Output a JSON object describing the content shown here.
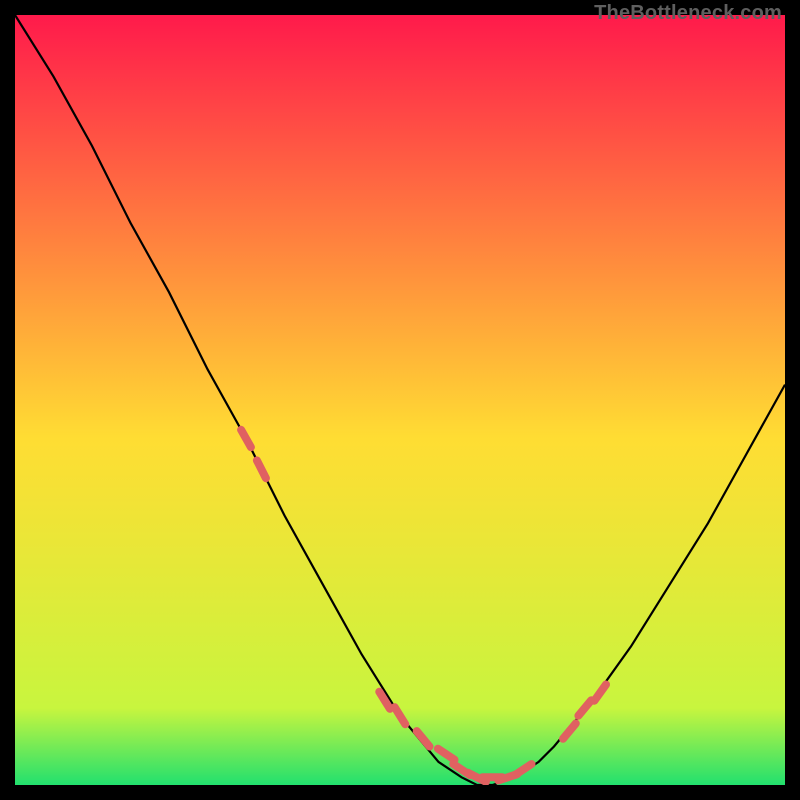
{
  "watermark": "TheBottleneck.com",
  "colors": {
    "bg": "#000000",
    "curve": "#000000",
    "marker": "#e06161",
    "grad_top": "#ff1a4b",
    "grad_mid": "#ffdd33",
    "grad_bottom": "#22e06e"
  },
  "chart_data": {
    "type": "line",
    "title": "",
    "xlabel": "",
    "ylabel": "",
    "xlim": [
      0,
      100
    ],
    "ylim": [
      0,
      100
    ],
    "grid": false,
    "legend_position": "none",
    "annotations": [
      "TheBottleneck.com"
    ],
    "series": [
      {
        "name": "bottleneck-curve",
        "x": [
          0,
          5,
          10,
          15,
          20,
          25,
          30,
          35,
          40,
          45,
          50,
          55,
          58,
          60,
          62,
          65,
          68,
          70,
          75,
          80,
          85,
          90,
          95,
          100
        ],
        "y": [
          100,
          92,
          83,
          73,
          64,
          54,
          45,
          35,
          26,
          17,
          9,
          3,
          1,
          0,
          0,
          1,
          3,
          5,
          11,
          18,
          26,
          34,
          43,
          52
        ]
      },
      {
        "name": "highlight-markers",
        "x": [
          30,
          32,
          48,
          50,
          53,
          56,
          58,
          60,
          62,
          64,
          66,
          72,
          74,
          76
        ],
        "y": [
          45,
          41,
          11,
          9,
          6,
          4,
          2,
          1,
          1,
          1,
          2,
          7,
          10,
          12
        ]
      }
    ]
  }
}
